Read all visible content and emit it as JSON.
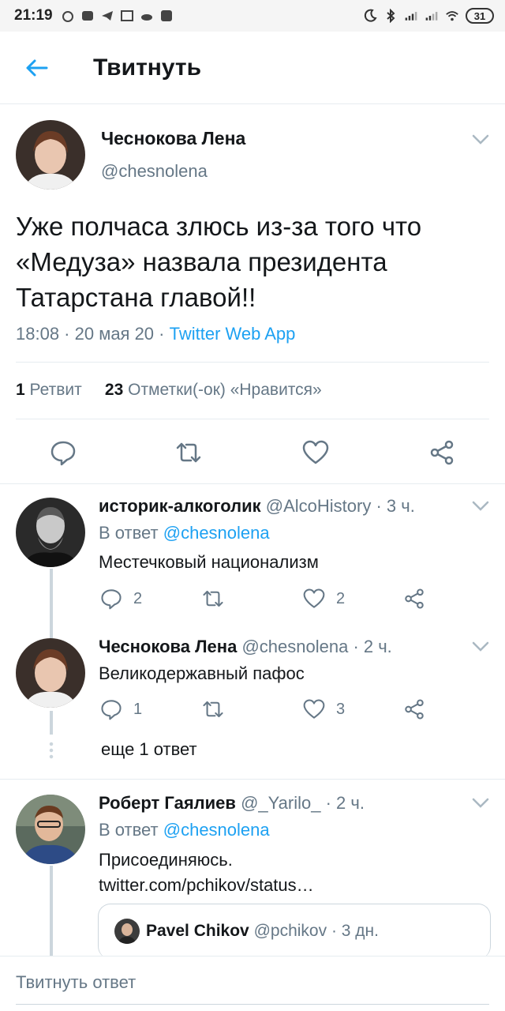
{
  "status_bar": {
    "time": "21:19",
    "battery": "31"
  },
  "header": {
    "title": "Твитнуть"
  },
  "main_tweet": {
    "name": "Чеснокова Лена",
    "handle": "@chesnolena",
    "text": "Уже полчаса злюсь из-за того что «Медуза» назвала президента Татарстана главой!!",
    "timestamp": "18:08 · 20 мая 20 · ",
    "app": "Twitter Web App",
    "retweets_count": "1",
    "retweets_label": "Ретвит",
    "likes_count": "23",
    "likes_label": "Отметки(-ок) «Нравится»"
  },
  "replies": [
    {
      "name": "историк-алкоголик",
      "handle": "@AlcoHistory",
      "time": "· 3 ч.",
      "in_reply_prefix": "В ответ ",
      "in_reply_to": "@chesnolena",
      "text": "Местечковый национализм",
      "replies": "2",
      "likes": "2"
    },
    {
      "name": "Чеснокова Лена",
      "handle": "@chesnolena",
      "time": "· 2 ч.",
      "text": "Великодержавный пафос",
      "replies": "1",
      "likes": "3"
    },
    {
      "name": "Роберт Гаялиев",
      "handle": "@_Yarilo_",
      "time": "· 2 ч.",
      "in_reply_prefix": "В ответ ",
      "in_reply_to": "@chesnolena",
      "text": "Присоединяюсь.",
      "link": "twitter.com/pchikov/status…",
      "quote": {
        "name": "Pavel Chikov",
        "handle": "@pchikov",
        "time": "· 3 дн."
      }
    }
  ],
  "more_replies": "еще 1 ответ",
  "reply_bar": {
    "placeholder": "Твитнуть ответ"
  },
  "colors": {
    "accent": "#1da1f2",
    "secondary_text": "#657786"
  }
}
